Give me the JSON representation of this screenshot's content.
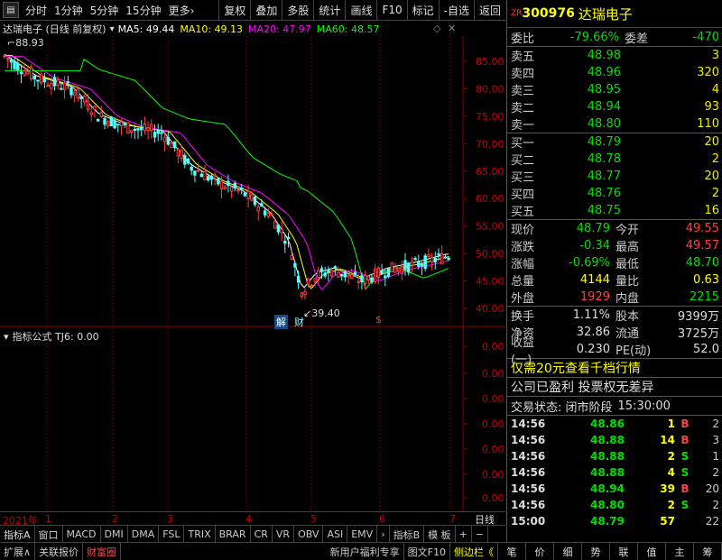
{
  "toolbar": {
    "tabs": [
      "分时",
      "1分钟",
      "5分钟",
      "15分钟",
      "更多›"
    ],
    "buttons": [
      "复权",
      "叠加",
      "多股",
      "统计",
      "画线",
      "F10",
      "标记",
      "-自选",
      "返回"
    ]
  },
  "legend": {
    "title": "达瑞电子 (日线 前复权)",
    "ma5": "MA5: 49.44",
    "ma10": "MA10: 49.13",
    "ma20": "MA20: 47.97",
    "ma60": "MA60: 48.57"
  },
  "price_axis": [
    "85.00",
    "80.00",
    "75.00",
    "70.00",
    "65.00",
    "60.00",
    "55.00",
    "50.00",
    "45.00",
    "40.00"
  ],
  "annotations": {
    "high": "88.93",
    "low": "39.40",
    "jie": "解",
    "cai": "财",
    "dollar": "$"
  },
  "indicator": {
    "title": "指标公式  TJ6: 0.00",
    "axis": [
      "0.00",
      "0.00",
      "0.00",
      "0.00",
      "0.00",
      "0.00",
      "0.00"
    ]
  },
  "xaxis": {
    "year": "2021年",
    "months": [
      "1",
      "2",
      "3",
      "4",
      "5",
      "6",
      "7"
    ],
    "period": "日线"
  },
  "indicator_tabs": [
    "指标A",
    "窗口",
    "MACD",
    "DMI",
    "DMA",
    "FSL",
    "TRIX",
    "BRAR",
    "CR",
    "VR",
    "OBV",
    "ASI",
    "EMV",
    "›",
    "指标B",
    "模 板",
    "+",
    "−"
  ],
  "status_bar": {
    "left": [
      "扩展∧",
      "关联报价",
      "财富圈"
    ],
    "right": [
      "新用户福利专享",
      "图文F10",
      "侧边栏《"
    ],
    "vtabs": [
      "笔",
      "价",
      "细",
      "势",
      "联",
      "值",
      "主",
      "筹"
    ]
  },
  "quote": {
    "tag": "ZR",
    "code": "300976",
    "name": "达瑞电子",
    "weibi_label": "委比",
    "weibi": "-79.66%",
    "weicha_label": "委差",
    "weicha": "-470",
    "asks": [
      {
        "label": "卖五",
        "price": "48.98",
        "vol": "3"
      },
      {
        "label": "卖四",
        "price": "48.96",
        "vol": "320"
      },
      {
        "label": "卖三",
        "price": "48.95",
        "vol": "4"
      },
      {
        "label": "卖二",
        "price": "48.94",
        "vol": "93"
      },
      {
        "label": "卖一",
        "price": "48.80",
        "vol": "110"
      }
    ],
    "bids": [
      {
        "label": "买一",
        "price": "48.79",
        "vol": "20"
      },
      {
        "label": "买二",
        "price": "48.78",
        "vol": "2"
      },
      {
        "label": "买三",
        "price": "48.77",
        "vol": "20"
      },
      {
        "label": "买四",
        "price": "48.76",
        "vol": "2"
      },
      {
        "label": "买五",
        "price": "48.75",
        "vol": "16"
      }
    ],
    "stats": [
      {
        "k": "现价",
        "v": "48.79",
        "vc": "green",
        "k2": "今开",
        "v2": "49.55",
        "v2c": "red"
      },
      {
        "k": "涨跌",
        "v": "-0.34",
        "vc": "green",
        "k2": "最高",
        "v2": "49.57",
        "v2c": "red"
      },
      {
        "k": "涨幅",
        "v": "-0.69%",
        "vc": "green",
        "k2": "最低",
        "v2": "48.70",
        "v2c": "green"
      },
      {
        "k": "总量",
        "v": "4144",
        "vc": "yellow",
        "k2": "量比",
        "v2": "0.63",
        "v2c": "yellow"
      },
      {
        "k": "外盘",
        "v": "1929",
        "vc": "red",
        "k2": "内盘",
        "v2": "2215",
        "v2c": "green"
      }
    ],
    "stats2": [
      {
        "k": "换手",
        "v": "1.11%",
        "k2": "股本",
        "v2": "9399万"
      },
      {
        "k": "净资",
        "v": "32.86",
        "k2": "流通",
        "v2": "3725万"
      },
      {
        "k": "收益(一)",
        "v": "0.230",
        "k2": "PE(动)",
        "v2": "52.0"
      }
    ],
    "promo": "仅需20元查看千档行情",
    "notice": "公司已盈利 投票权无差异",
    "trade_status_label": "交易状态: 闭市阶段",
    "trade_status_time": "15:30:00",
    "ticks": [
      {
        "t": "14:56",
        "p": "48.86",
        "pc": "green",
        "v": "1",
        "s": "B",
        "sc": "red",
        "n": "2"
      },
      {
        "t": "14:56",
        "p": "48.88",
        "pc": "green",
        "v": "14",
        "s": "B",
        "sc": "red",
        "n": "3"
      },
      {
        "t": "14:56",
        "p": "48.88",
        "pc": "green",
        "v": "2",
        "s": "S",
        "sc": "green",
        "n": "1"
      },
      {
        "t": "14:56",
        "p": "48.88",
        "pc": "green",
        "v": "4",
        "s": "S",
        "sc": "green",
        "n": "2"
      },
      {
        "t": "14:56",
        "p": "48.94",
        "pc": "green",
        "v": "39",
        "s": "B",
        "sc": "red",
        "n": "20"
      },
      {
        "t": "14:56",
        "p": "48.80",
        "pc": "green",
        "v": "2",
        "s": "S",
        "sc": "green",
        "n": "2"
      },
      {
        "t": "15:00",
        "p": "48.79",
        "pc": "green",
        "v": "57",
        "s": "",
        "sc": "green",
        "n": "22"
      }
    ]
  },
  "colors": {
    "up": "#ff4040",
    "down": "#00e000",
    "ma5": "#ffffff",
    "ma10": "#ffff00",
    "ma20": "#ff00ff",
    "ma60": "#00ff00"
  }
}
